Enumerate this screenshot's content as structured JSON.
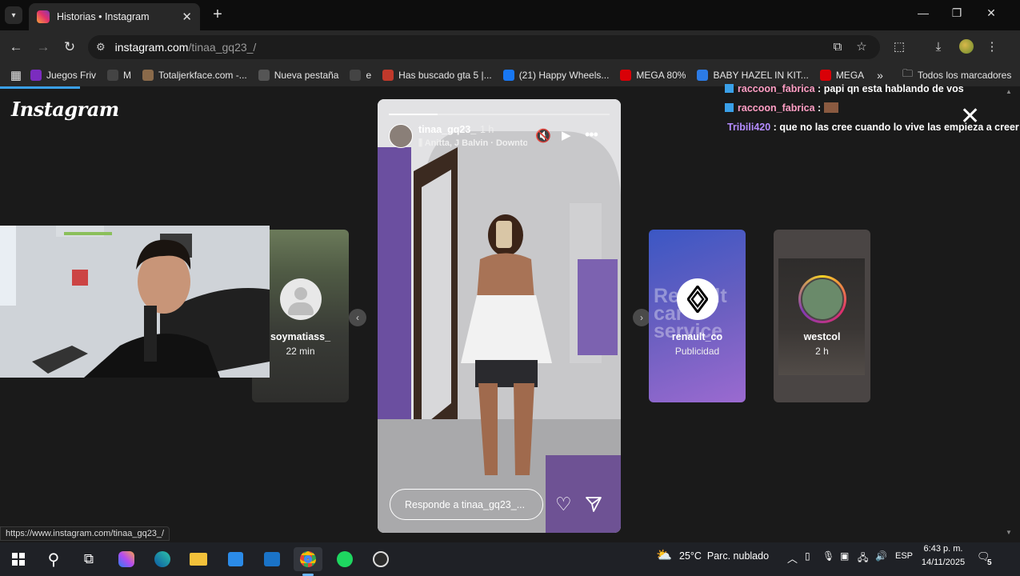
{
  "browser": {
    "tab_title": "Historias • Instagram",
    "url_host": "instagram.com",
    "url_path": "/tinaa_gq23_/",
    "status_url": "https://www.instagram.com/tinaa_gq23_/",
    "bookmarks": [
      {
        "label": "Juegos Friv",
        "icon": "friv-icon",
        "color": "#7b2cbf"
      },
      {
        "label": "M",
        "icon": "google-icon",
        "color": "#444"
      },
      {
        "label": "Totaljerkface.com -...",
        "icon": "site-icon",
        "color": "#8a6a4a"
      },
      {
        "label": "Nueva pestaña",
        "icon": "chrome-icon",
        "color": "#555"
      },
      {
        "label": "e",
        "icon": "google-icon",
        "color": "#444"
      },
      {
        "label": "Has buscado gta 5 |...",
        "icon": "gta-icon",
        "color": "#c0392b"
      },
      {
        "label": "(21) Happy Wheels...",
        "icon": "facebook-icon",
        "color": "#1877f2"
      },
      {
        "label": "MEGA 80%",
        "icon": "mega-icon",
        "color": "#d90007"
      },
      {
        "label": "BABY HAZEL IN KIT...",
        "icon": "site-icon",
        "color": "#2c7be5"
      },
      {
        "label": "MEGA",
        "icon": "mega-icon",
        "color": "#d90007"
      }
    ],
    "more_bookmarks": "»",
    "all_bookmarks_label": "Todos los marcadores"
  },
  "instagram": {
    "logo": "Instagram",
    "story": {
      "username": "tinaa_gq23_",
      "time": "1 h",
      "music": "Anitta, J Balvin · Downtown",
      "reply_placeholder": "Responde a tinaa_gq23_...",
      "progress": 0.22
    },
    "side_stories": [
      {
        "name": "soymatiass_",
        "sub": "22 min"
      },
      {
        "name": "renault_co",
        "sub": "Publicidad",
        "bg_text": "Renault car service"
      },
      {
        "name": "westcol",
        "sub": "2 h"
      }
    ]
  },
  "chat": [
    {
      "user": "raccoon_fabrica",
      "sep": " : ",
      "msg": "papi qn esta hablando de vos",
      "color": "#ff9ec4"
    },
    {
      "user": "raccoon_fabrica",
      "sep": " : ",
      "msg": "",
      "color": "#ff9ec4"
    },
    {
      "user": "Tribili420",
      "sep": " : ",
      "msg": "que no las cree cuando lo vive las empieza a creer",
      "color": "#b48cff"
    }
  ],
  "taskbar": {
    "weather_temp": "25°C",
    "weather_desc": "Parc. nublado",
    "language": "ESP",
    "time": "6:43 p. m.",
    "date": "14/11/2025",
    "notifications": "5"
  }
}
